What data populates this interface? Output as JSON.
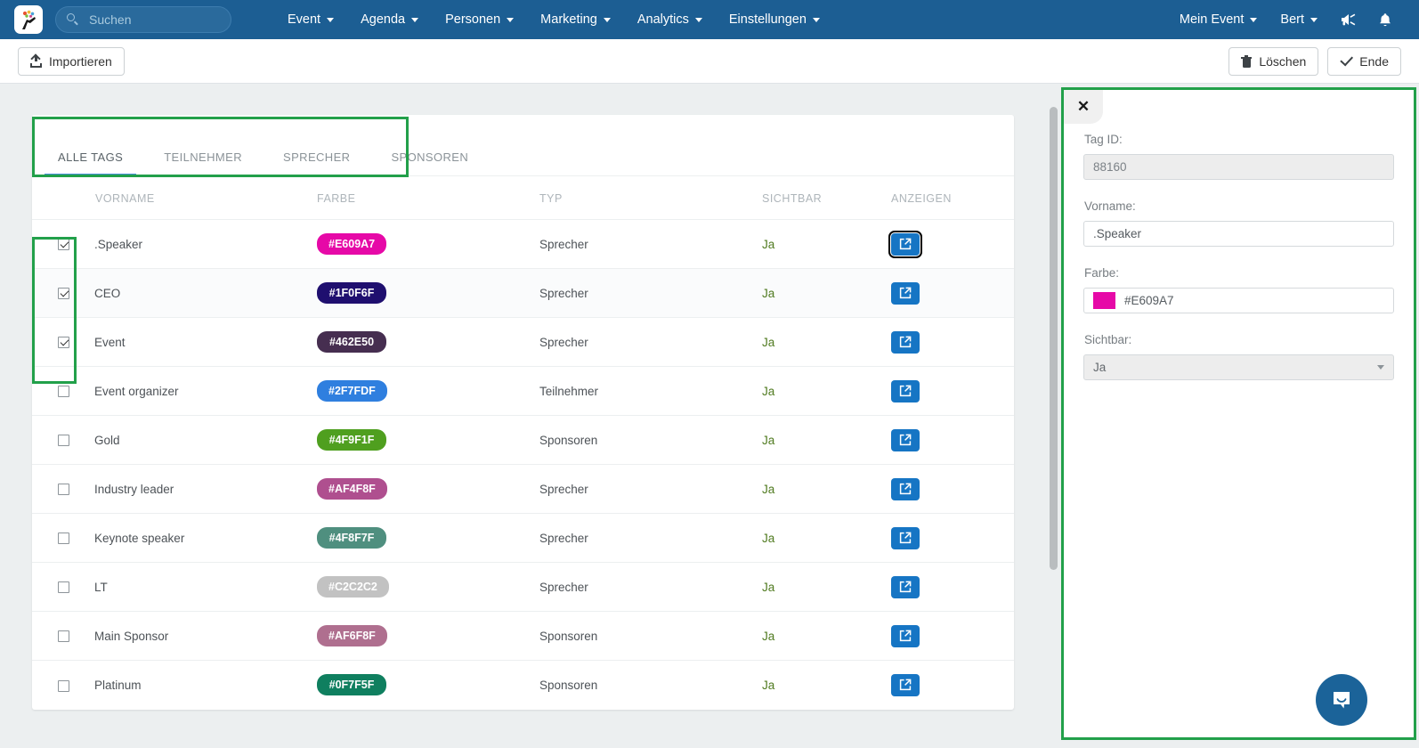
{
  "navbar": {
    "logo_icon": "app-logo-icon",
    "search": {
      "placeholder": "Suchen",
      "value": ""
    },
    "menu": [
      {
        "label": "Event"
      },
      {
        "label": "Agenda"
      },
      {
        "label": "Personen"
      },
      {
        "label": "Marketing"
      },
      {
        "label": "Analytics"
      },
      {
        "label": "Einstellungen"
      }
    ],
    "right": [
      {
        "label": "Mein Event"
      },
      {
        "label": "Bert"
      }
    ],
    "announce_icon": "megaphone-icon",
    "bell_icon": "bell-icon",
    "bg_color": "#1c5e93"
  },
  "toolbar": {
    "import_label": "Importieren",
    "delete_label": "Löschen",
    "end_label": "Ende"
  },
  "tabs": [
    {
      "label": "ALLE TAGS",
      "active": true
    },
    {
      "label": "TEILNEHMER",
      "active": false
    },
    {
      "label": "SPRECHER",
      "active": false
    },
    {
      "label": "SPONSOREN",
      "active": false
    }
  ],
  "table": {
    "columns": [
      "",
      "VORNAME",
      "FARBE",
      "TYP",
      "SICHTBAR",
      "ANZEIGEN"
    ],
    "rows": [
      {
        "checked": true,
        "name": ".Speaker",
        "color": "#E609A7",
        "typ": "Sprecher",
        "visible": "Ja",
        "focused": true
      },
      {
        "checked": true,
        "name": "CEO",
        "color": "#1F0F6F",
        "typ": "Sprecher",
        "visible": "Ja",
        "focused": false
      },
      {
        "checked": true,
        "name": "Event",
        "color": "#462E50",
        "typ": "Sprecher",
        "visible": "Ja",
        "focused": false
      },
      {
        "checked": false,
        "name": "Event organizer",
        "color": "#2F7FDF",
        "typ": "Teilnehmer",
        "visible": "Ja",
        "focused": false
      },
      {
        "checked": false,
        "name": "Gold",
        "color": "#4F9F1F",
        "typ": "Sponsoren",
        "visible": "Ja",
        "focused": false
      },
      {
        "checked": false,
        "name": "Industry leader",
        "color": "#AF4F8F",
        "typ": "Sprecher",
        "visible": "Ja",
        "focused": false
      },
      {
        "checked": false,
        "name": "Keynote speaker",
        "color": "#4F8F7F",
        "typ": "Sprecher",
        "visible": "Ja",
        "focused": false
      },
      {
        "checked": false,
        "name": "LT",
        "color": "#C2C2C2",
        "typ": "Sprecher",
        "visible": "Ja",
        "focused": false
      },
      {
        "checked": false,
        "name": "Main Sponsor",
        "color": "#AF6F8F",
        "typ": "Sponsoren",
        "visible": "Ja",
        "focused": false
      },
      {
        "checked": false,
        "name": "Platinum",
        "color": "#0F7F5F",
        "typ": "Sponsoren",
        "visible": "Ja",
        "focused": false
      }
    ]
  },
  "panel": {
    "close_label": "✕",
    "fields": {
      "tag_id_label": "Tag ID:",
      "tag_id_value": "88160",
      "vorname_label": "Vorname:",
      "vorname_value": ".Speaker",
      "farbe_label": "Farbe:",
      "farbe_value": "#E609A7",
      "sichtbar_label": "Sichtbar:",
      "sichtbar_value": "Ja"
    }
  },
  "chat": {
    "icon": "chat-bubble-icon",
    "color": "#1b6399"
  },
  "annotations": {
    "highlight_color": "#22a04a"
  }
}
